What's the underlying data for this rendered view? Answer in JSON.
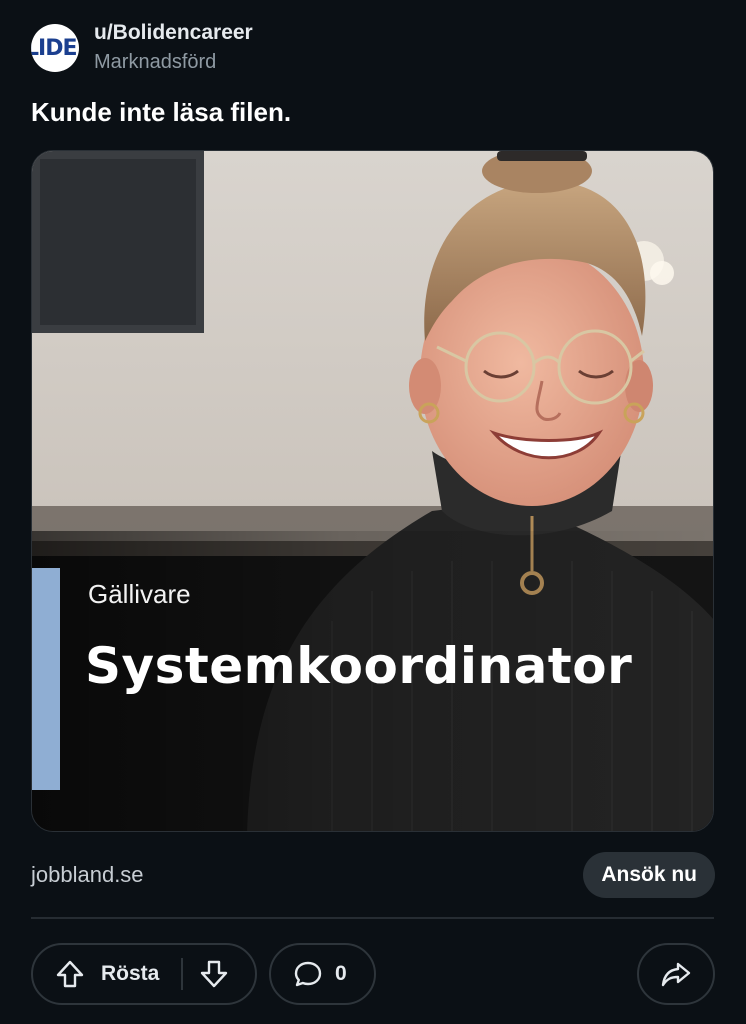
{
  "post": {
    "avatar_text": "LIDE",
    "username": "u/Bolidencareer",
    "promoted_label": "Marknadsförd",
    "title": "Kunde inte läsa filen."
  },
  "media": {
    "location": "Gällivare",
    "job_title": "Systemkoordinator",
    "accent_color": "#8faed3"
  },
  "link": {
    "domain": "jobbland.se",
    "cta_label": "Ansök nu"
  },
  "actions": {
    "vote_label": "Rösta",
    "comment_count": "0",
    "icons": [
      "arrow-up-icon",
      "arrow-down-icon",
      "comment-icon",
      "share-icon"
    ]
  },
  "colors": {
    "background": "#0b1015",
    "pill_border": "#2e353b",
    "cta_bg": "#2a3137",
    "muted_text": "#8f9aa3"
  }
}
